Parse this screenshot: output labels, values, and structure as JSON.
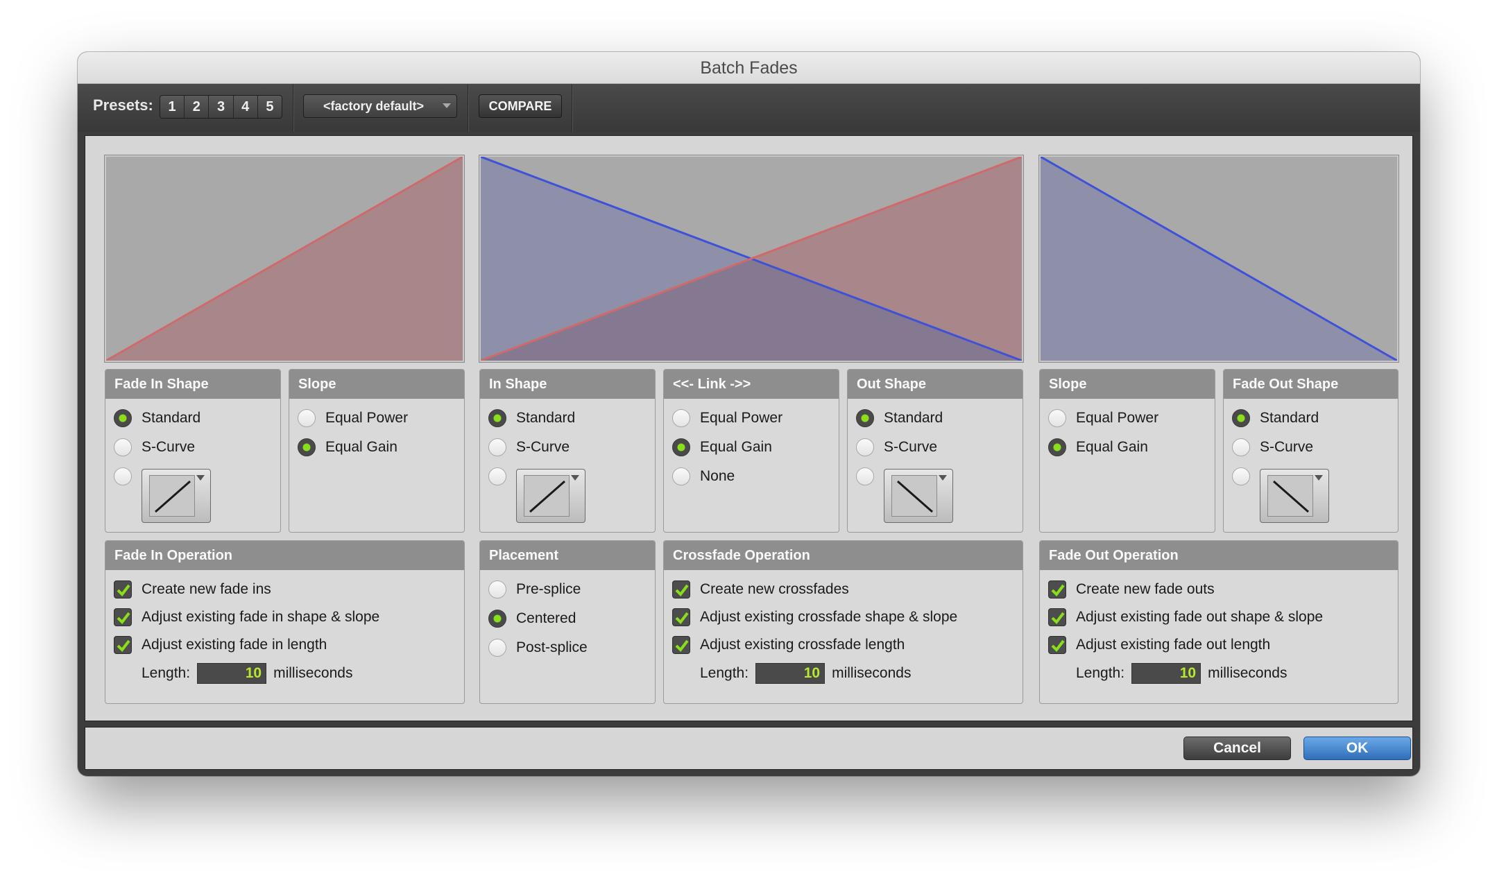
{
  "window": {
    "title": "Batch Fades"
  },
  "toolbar": {
    "presets_label": "Presets:",
    "preset_buttons": [
      "1",
      "2",
      "3",
      "4",
      "5"
    ],
    "preset_selected": "<factory default>",
    "compare_label": "COMPARE"
  },
  "colors": {
    "fade_in_line": "#d06a6a",
    "fade_out_line": "#3e52d8",
    "fade_in_fill": "#a8868a",
    "fade_out_fill": "#8e8fa8",
    "overlap_fill": "#857891",
    "graph_bg": "#a9a9a9",
    "radio_on": "#8adf1c",
    "length_text": "#b7ea2e",
    "ok_button": "#3d7fcc"
  },
  "panels": {
    "fade_in_shape": {
      "title": "Fade In Shape",
      "options": [
        "Standard",
        "S-Curve"
      ],
      "selected": 0,
      "custom_icon": "rising-line-icon"
    },
    "fade_in_slope": {
      "title": "Slope",
      "options": [
        "Equal Power",
        "Equal Gain"
      ],
      "selected": 1
    },
    "in_shape": {
      "title": "In Shape",
      "options": [
        "Standard",
        "S-Curve"
      ],
      "selected": 0,
      "custom_icon": "rising-line-icon"
    },
    "link": {
      "title": "<<- Link ->>",
      "options": [
        "Equal Power",
        "Equal Gain",
        "None"
      ],
      "selected": 1
    },
    "out_shape": {
      "title": "Out Shape",
      "options": [
        "Standard",
        "S-Curve"
      ],
      "selected": 0,
      "custom_icon": "falling-line-icon"
    },
    "fade_out_slope": {
      "title": "Slope",
      "options": [
        "Equal Power",
        "Equal Gain"
      ],
      "selected": 1
    },
    "fade_out_shape": {
      "title": "Fade Out Shape",
      "options": [
        "Standard",
        "S-Curve"
      ],
      "selected": 0,
      "custom_icon": "falling-line-icon"
    }
  },
  "operations": {
    "fade_in": {
      "title": "Fade In Operation",
      "checks": [
        "Create new fade ins",
        "Adjust existing fade in shape & slope",
        "Adjust existing fade in length"
      ],
      "checked": [
        true,
        true,
        true
      ],
      "length_label": "Length:",
      "length_value": "10",
      "length_unit": "milliseconds"
    },
    "placement": {
      "title": "Placement",
      "options": [
        "Pre-splice",
        "Centered",
        "Post-splice"
      ],
      "selected": 1
    },
    "crossfade": {
      "title": "Crossfade Operation",
      "checks": [
        "Create new crossfades",
        "Adjust existing crossfade shape & slope",
        "Adjust existing crossfade length"
      ],
      "checked": [
        true,
        true,
        true
      ],
      "length_label": "Length:",
      "length_value": "10",
      "length_unit": "milliseconds"
    },
    "fade_out": {
      "title": "Fade Out Operation",
      "checks": [
        "Create new fade outs",
        "Adjust existing fade out shape & slope",
        "Adjust existing fade out length"
      ],
      "checked": [
        true,
        true,
        true
      ],
      "length_label": "Length:",
      "length_value": "10",
      "length_unit": "milliseconds"
    }
  },
  "footer": {
    "cancel_label": "Cancel",
    "ok_label": "OK"
  }
}
